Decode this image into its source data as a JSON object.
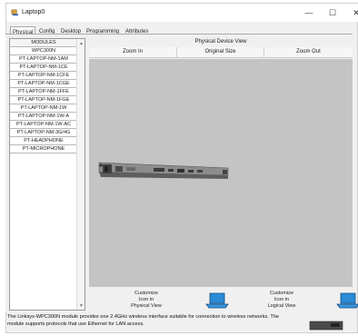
{
  "window": {
    "title": "Laptop0",
    "minimize_glyph": "—",
    "maximize_glyph": "☐",
    "close_glyph": "✕"
  },
  "tabs": [
    {
      "label": "Physical",
      "active": true
    },
    {
      "label": "Config",
      "active": false
    },
    {
      "label": "Desktop",
      "active": false
    },
    {
      "label": "Programming",
      "active": false
    },
    {
      "label": "Attributes",
      "active": false
    }
  ],
  "modules": {
    "header": "MODULES",
    "items": [
      "WPC300N",
      "PT-LAPTOP-NM-1AM",
      "PT-LAPTOP-NM-1CE",
      "PT-LAPTOP-NM-1CFE",
      "PT-LAPTOP-NM-1CGE",
      "PT-LAPTOP-NM-1FFE",
      "PT-LAPTOP-NM-1FGE",
      "PT-LAPTOP-NM-1W",
      "PT-LAPTOP-NM-1W-A",
      "PT-LAPTOP-NM-1W-AC",
      "PT-LAPTOP-NM-3G/4G",
      "PT-HEADPHONE",
      "PT-MICROPHONE"
    ]
  },
  "device_view": {
    "header": "Physical Device View",
    "zoom_in": "Zoom In",
    "original_size": "Original Size",
    "zoom_out": "Zoom Out"
  },
  "customize": {
    "physical_line1": "Customize",
    "physical_line2": "Icon in",
    "physical_line3": "Physical View",
    "logical_line1": "Customize",
    "logical_line2": "Icon in",
    "logical_line3": "Logical View"
  },
  "description": "The Linksys-WPC300N module provides one 2.4GHz wireless interface suitable for connection to wireless networks. The module supports protocols that use Ethernet for LAN access.",
  "colors": {
    "canvas_bg": "#c4c4c4",
    "panel_bg": "#f0f0f0",
    "accent_blue": "#2a8bd6"
  },
  "icons": {
    "app": "laptop-app-icon",
    "scroll_up": "▲",
    "scroll_down": "▼"
  }
}
